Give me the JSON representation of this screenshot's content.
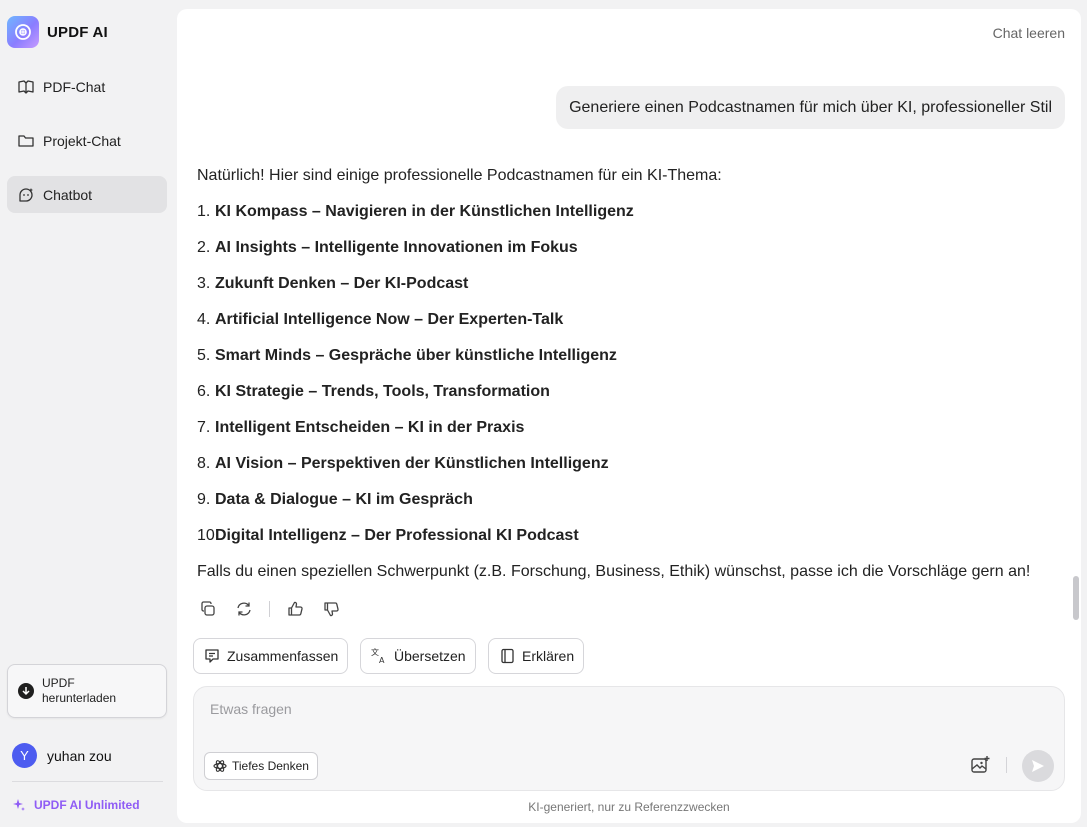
{
  "app": {
    "title": "UPDF AI"
  },
  "sidebar": {
    "items": [
      {
        "label": "PDF-Chat",
        "icon": "book-open-icon"
      },
      {
        "label": "Projekt-Chat",
        "icon": "folder-icon"
      },
      {
        "label": "Chatbot",
        "icon": "chatbot-icon",
        "active": true
      }
    ],
    "download_label": "UPDF herunterladen",
    "user": {
      "initial": "Y",
      "name": "yuhan zou"
    },
    "unlimited_label": "UPDF AI Unlimited"
  },
  "header": {
    "clear_chat": "Chat leeren"
  },
  "conversation": {
    "user_message": "Generiere einen Podcastnamen für mich über KI, professioneller Stil",
    "answer_intro": "Natürlich! Hier sind einige professionelle Podcastnamen für ein KI-Thema:",
    "items": [
      {
        "num": "1.",
        "text": "KI Kompass – Navigieren in der Künstlichen Intelligenz"
      },
      {
        "num": "2.",
        "text": "AI Insights – Intelligente Innovationen im Fokus"
      },
      {
        "num": "3.",
        "text": "Zukunft Denken – Der KI-Podcast"
      },
      {
        "num": "4.",
        "text": "Artificial Intelligence Now – Der Experten-Talk"
      },
      {
        "num": "5.",
        "text": "Smart Minds – Gespräche über künstliche Intelligenz"
      },
      {
        "num": "6.",
        "text": "KI Strategie – Trends, Tools, Transformation"
      },
      {
        "num": "7.",
        "text": "Intelligent Entscheiden – KI in der Praxis"
      },
      {
        "num": "8.",
        "text": "AI Vision – Perspektiven der Künstlichen Intelligenz"
      },
      {
        "num": "9.",
        "text": "Data & Dialogue – KI im Gespräch"
      },
      {
        "num": "10",
        "text": "Digital Intelligenz – Der Professional KI Podcast"
      }
    ],
    "answer_outro": "Falls du einen speziellen Schwerpunkt (z.B. Forschung, Business, Ethik) wünschst, passe ich die Vorschläge gern an!"
  },
  "quick_actions": [
    {
      "label": "Zusammenfassen",
      "icon": "summarize-icon"
    },
    {
      "label": "Übersetzen",
      "icon": "translate-icon"
    },
    {
      "label": "Erklären",
      "icon": "book-icon"
    }
  ],
  "composer": {
    "placeholder": "Etwas fragen",
    "value": "",
    "deep_think_label": "Tiefes Denken"
  },
  "footer": {
    "disclaimer": "KI-generiert, nur zu Referenzzwecken"
  },
  "colors": {
    "accent": "#8f5cf5",
    "avatar": "#4d5cf0",
    "sidebar_bg": "#f2f2f3",
    "active_nav": "#e2e2e4"
  }
}
